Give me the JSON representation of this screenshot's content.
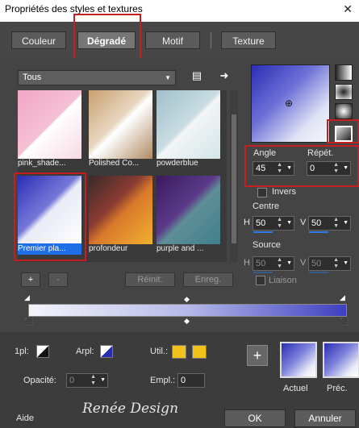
{
  "window": {
    "title": "Propriétés des styles et textures",
    "close_glyph": "✕"
  },
  "tabs": [
    {
      "label": "Couleur"
    },
    {
      "label": "Dégradé"
    },
    {
      "label": "Motif"
    },
    {
      "label": "Texture"
    }
  ],
  "library": {
    "dropdown_value": "Tous",
    "thumbnails": [
      {
        "label": "pink_shade...",
        "icon": "gradient-thumbnail"
      },
      {
        "label": "Polished Co...",
        "icon": "gradient-thumbnail"
      },
      {
        "label": "powderblue",
        "icon": "gradient-thumbnail"
      },
      {
        "label": "Premier pla...",
        "icon": "gradient-thumbnail",
        "selected": true
      },
      {
        "label": "profondeur",
        "icon": "gradient-thumbnail"
      },
      {
        "label": "purple and ...",
        "icon": "gradient-thumbnail"
      }
    ],
    "buttons": {
      "add": "+",
      "remove": "-",
      "reset": "Réinit.",
      "save": "Enreg."
    }
  },
  "settings": {
    "angle_label": "Angle",
    "angle_value": "45",
    "repeat_label": "Répét.",
    "repeat_value": "0",
    "invert_label": "Invers",
    "center_label": "Centre",
    "center_h_label": "H",
    "center_h": "50",
    "center_v_label": "V",
    "center_v": "50",
    "source_label": "Source",
    "source_h_label": "H",
    "source_h": "50",
    "source_v_label": "V",
    "source_v": "50",
    "link_label": "Liaison"
  },
  "footer": {
    "1pl_label": "1pl:",
    "arpl_label": "Arpl:",
    "util_label": "Util.:",
    "opacity_label": "Opacité:",
    "opacity_value": "0",
    "empl_label": "Empl.:",
    "empl_value": "0",
    "current_label": "Actuel",
    "previous_label": "Préc.",
    "logo_text": "Renée Design",
    "help": "Aide",
    "ok": "OK",
    "cancel": "Annuler"
  },
  "colors": {
    "highlight_red": "#c61f1f",
    "selection_blue": "#1e6ee8",
    "gradient_start": "#2a2db4",
    "gradient_end": "#ffffff",
    "util_yellow": "#f1c21b"
  }
}
